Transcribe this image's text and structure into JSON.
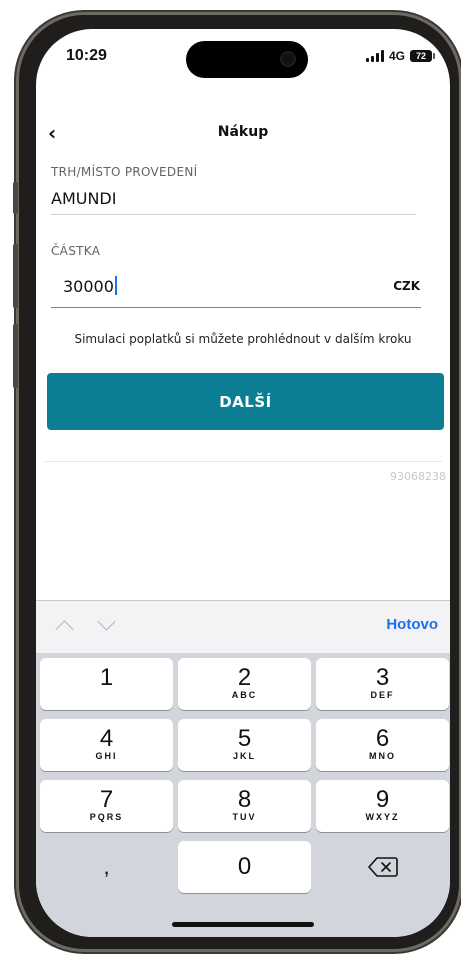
{
  "status_bar": {
    "time": "10:29",
    "network": "4G",
    "battery_level": "72"
  },
  "nav": {
    "back_icon": "chevron-left-icon",
    "title": "Nákup"
  },
  "form": {
    "market_label": "TRH/MÍSTO PROVEDENÍ",
    "market_value": "AMUNDI",
    "amount_label": "ČÁSTKA",
    "amount_value": "30000",
    "currency": "CZK",
    "hint": "Simulaci poplatků si můžete prohlédnout v dalším kroku",
    "next_label": "DALŠÍ",
    "reference_id": "93068238"
  },
  "colors": {
    "primary": "#0b7e94",
    "active_underline": "#2aa1b4",
    "link_blue": "#1a73e8"
  },
  "keyboard": {
    "done_label": "Hotovo",
    "keys": [
      {
        "digit": "1",
        "letters": ""
      },
      {
        "digit": "2",
        "letters": "ABC"
      },
      {
        "digit": "3",
        "letters": "DEF"
      },
      {
        "digit": "4",
        "letters": "GHI"
      },
      {
        "digit": "5",
        "letters": "JKL"
      },
      {
        "digit": "6",
        "letters": "MNO"
      },
      {
        "digit": "7",
        "letters": "PQRS"
      },
      {
        "digit": "8",
        "letters": "TUV"
      },
      {
        "digit": "9",
        "letters": "WXYZ"
      },
      {
        "digit": "0",
        "letters": ""
      }
    ],
    "comma_label": ","
  }
}
